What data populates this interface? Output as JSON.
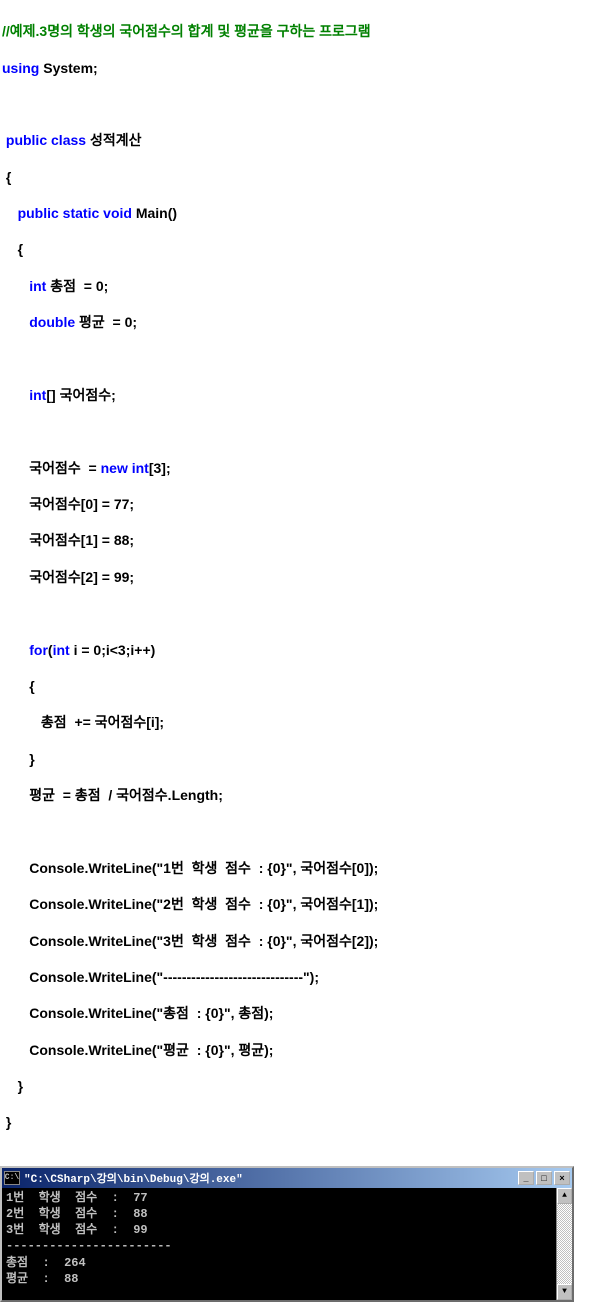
{
  "code": {
    "comment": "//예제.3명의 학생의 국어점수의 합계 및 평균을 구하는 프로그램",
    "using_kw": "using",
    "using_ns": " System;",
    "public_kw": "public",
    "class_kw": " class ",
    "class_name": "성적계산",
    "brace_open": "{",
    "static_kw": " static ",
    "void_kw": "void ",
    "main_sig": "Main()",
    "int_kw": "int",
    "var_total": " 총점  = 0;",
    "double_kw": "double",
    "var_avg": " 평균  = 0;",
    "arr_brackets": "[] ",
    "arr_decl": "국어점수;",
    "arr_assign": "국어점수  = ",
    "new_kw": "new",
    "new_int": " int",
    "new_size": "[3];",
    "arr0": "국어점수[0] = 77;",
    "arr1": "국어점수[1] = 88;",
    "arr2": "국어점수[2] = 99;",
    "for_kw": "for",
    "for_open": "(",
    "for_var": " i = 0;i<3;i++)",
    "for_body": "   총점  += 국어점수[i];",
    "brace_close": "}",
    "avg_calc": "평균  = 총점  / 국어점수.Length;",
    "cw1": "Console.WriteLine(\"1번  학생  점수  : {0}\", 국어점수[0]);",
    "cw2": "Console.WriteLine(\"2번  학생  점수  : {0}\", 국어점수[1]);",
    "cw3": "Console.WriteLine(\"3번  학생  점수  : {0}\", 국어점수[2]);",
    "cw4": "Console.WriteLine(\"------------------------------\");",
    "cw5": "Console.WriteLine(\"총점  : {0}\", 총점);",
    "cw6": "Console.WriteLine(\"평균  : {0}\", 평균);"
  },
  "console": {
    "title_icon": "C:\\",
    "title": "\"C:\\CSharp\\강의\\bin\\Debug\\강의.exe\"",
    "lines": {
      "l0": "1번  학생  점수  :  77",
      "l1": "2번  학생  점수  :  88",
      "l2": "3번  학생  점수  :  99",
      "l3": "-----------------------",
      "l4": "총점  :  264",
      "l5": "평균  :  88"
    },
    "buttons": {
      "min": "_",
      "max": "□",
      "close": "×"
    },
    "scroll": {
      "up": "▲",
      "down": "▼"
    }
  }
}
